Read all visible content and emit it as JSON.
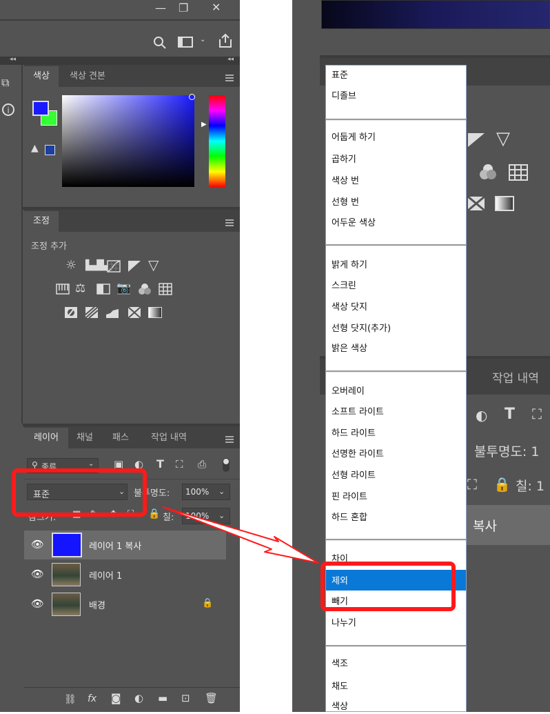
{
  "window": {
    "minimize": "—",
    "restore": "❐",
    "close": "✕"
  },
  "toolbar": {
    "search_icon": "search-icon",
    "view_icon": "panel-icon",
    "share_icon": "share-icon"
  },
  "color_panel": {
    "tabs": [
      "색상",
      "색상 견본"
    ],
    "fg": "#1a1aff",
    "bg": "#33ff33"
  },
  "adjust_panel": {
    "tab": "조정",
    "add_label": "조정 추가"
  },
  "layers_panel": {
    "tabs": [
      "레이어",
      "채널",
      "패스",
      "작업 내역"
    ],
    "filter": "종류",
    "blend_mode": "표준",
    "opacity_label": "불투명도:",
    "opacity": "100%",
    "fill_label": "칠:",
    "fill": "100%",
    "lock_label": "잠그기:",
    "layers": [
      {
        "name": "레이어 1 복사",
        "type": "fill",
        "selected": true
      },
      {
        "name": "레이어 1",
        "type": "photo",
        "selected": false
      },
      {
        "name": "배경",
        "type": "photo",
        "selected": false,
        "locked": true
      }
    ]
  },
  "right_bg": {
    "tab": "작업 내역",
    "opacity_label": "불투명도: 1",
    "fill_label": "칠: 1",
    "layer_name": "복사"
  },
  "blend_menu": {
    "groups": [
      [
        "표준",
        "디졸브"
      ],
      [
        "어둡게 하기",
        "곱하기",
        "색상 번",
        "선형 번",
        "어두운 색상"
      ],
      [
        "밝게 하기",
        "스크린",
        "색상 닷지",
        "선형 닷지(추가)",
        "밝은 색상"
      ],
      [
        "오버레이",
        "소프트 라이트",
        "하드 라이트",
        "선명한 라이트",
        "선형 라이트",
        "핀 라이트",
        "하드 혼합"
      ],
      [
        "차이",
        "제외",
        "빼기",
        "나누기"
      ],
      [
        "색조",
        "채도",
        "색상"
      ]
    ],
    "selected": "제외"
  },
  "colors": {
    "panel": "#535353",
    "annotation": "#ff1a1a",
    "selection": "#0a78d7"
  }
}
